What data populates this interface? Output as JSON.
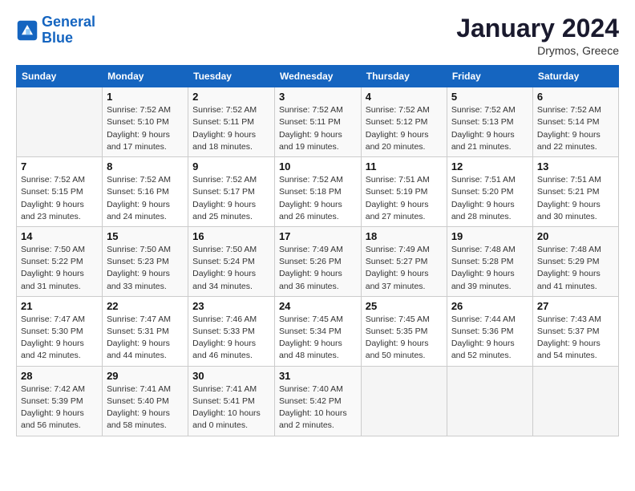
{
  "logo": {
    "line1": "General",
    "line2": "Blue"
  },
  "header": {
    "month": "January 2024",
    "location": "Drymos, Greece"
  },
  "columns": [
    "Sunday",
    "Monday",
    "Tuesday",
    "Wednesday",
    "Thursday",
    "Friday",
    "Saturday"
  ],
  "weeks": [
    [
      {
        "day": "",
        "detail": ""
      },
      {
        "day": "1",
        "detail": "Sunrise: 7:52 AM\nSunset: 5:10 PM\nDaylight: 9 hours\nand 17 minutes."
      },
      {
        "day": "2",
        "detail": "Sunrise: 7:52 AM\nSunset: 5:11 PM\nDaylight: 9 hours\nand 18 minutes."
      },
      {
        "day": "3",
        "detail": "Sunrise: 7:52 AM\nSunset: 5:11 PM\nDaylight: 9 hours\nand 19 minutes."
      },
      {
        "day": "4",
        "detail": "Sunrise: 7:52 AM\nSunset: 5:12 PM\nDaylight: 9 hours\nand 20 minutes."
      },
      {
        "day": "5",
        "detail": "Sunrise: 7:52 AM\nSunset: 5:13 PM\nDaylight: 9 hours\nand 21 minutes."
      },
      {
        "day": "6",
        "detail": "Sunrise: 7:52 AM\nSunset: 5:14 PM\nDaylight: 9 hours\nand 22 minutes."
      }
    ],
    [
      {
        "day": "7",
        "detail": "Sunrise: 7:52 AM\nSunset: 5:15 PM\nDaylight: 9 hours\nand 23 minutes."
      },
      {
        "day": "8",
        "detail": "Sunrise: 7:52 AM\nSunset: 5:16 PM\nDaylight: 9 hours\nand 24 minutes."
      },
      {
        "day": "9",
        "detail": "Sunrise: 7:52 AM\nSunset: 5:17 PM\nDaylight: 9 hours\nand 25 minutes."
      },
      {
        "day": "10",
        "detail": "Sunrise: 7:52 AM\nSunset: 5:18 PM\nDaylight: 9 hours\nand 26 minutes."
      },
      {
        "day": "11",
        "detail": "Sunrise: 7:51 AM\nSunset: 5:19 PM\nDaylight: 9 hours\nand 27 minutes."
      },
      {
        "day": "12",
        "detail": "Sunrise: 7:51 AM\nSunset: 5:20 PM\nDaylight: 9 hours\nand 28 minutes."
      },
      {
        "day": "13",
        "detail": "Sunrise: 7:51 AM\nSunset: 5:21 PM\nDaylight: 9 hours\nand 30 minutes."
      }
    ],
    [
      {
        "day": "14",
        "detail": "Sunrise: 7:50 AM\nSunset: 5:22 PM\nDaylight: 9 hours\nand 31 minutes."
      },
      {
        "day": "15",
        "detail": "Sunrise: 7:50 AM\nSunset: 5:23 PM\nDaylight: 9 hours\nand 33 minutes."
      },
      {
        "day": "16",
        "detail": "Sunrise: 7:50 AM\nSunset: 5:24 PM\nDaylight: 9 hours\nand 34 minutes."
      },
      {
        "day": "17",
        "detail": "Sunrise: 7:49 AM\nSunset: 5:26 PM\nDaylight: 9 hours\nand 36 minutes."
      },
      {
        "day": "18",
        "detail": "Sunrise: 7:49 AM\nSunset: 5:27 PM\nDaylight: 9 hours\nand 37 minutes."
      },
      {
        "day": "19",
        "detail": "Sunrise: 7:48 AM\nSunset: 5:28 PM\nDaylight: 9 hours\nand 39 minutes."
      },
      {
        "day": "20",
        "detail": "Sunrise: 7:48 AM\nSunset: 5:29 PM\nDaylight: 9 hours\nand 41 minutes."
      }
    ],
    [
      {
        "day": "21",
        "detail": "Sunrise: 7:47 AM\nSunset: 5:30 PM\nDaylight: 9 hours\nand 42 minutes."
      },
      {
        "day": "22",
        "detail": "Sunrise: 7:47 AM\nSunset: 5:31 PM\nDaylight: 9 hours\nand 44 minutes."
      },
      {
        "day": "23",
        "detail": "Sunrise: 7:46 AM\nSunset: 5:33 PM\nDaylight: 9 hours\nand 46 minutes."
      },
      {
        "day": "24",
        "detail": "Sunrise: 7:45 AM\nSunset: 5:34 PM\nDaylight: 9 hours\nand 48 minutes."
      },
      {
        "day": "25",
        "detail": "Sunrise: 7:45 AM\nSunset: 5:35 PM\nDaylight: 9 hours\nand 50 minutes."
      },
      {
        "day": "26",
        "detail": "Sunrise: 7:44 AM\nSunset: 5:36 PM\nDaylight: 9 hours\nand 52 minutes."
      },
      {
        "day": "27",
        "detail": "Sunrise: 7:43 AM\nSunset: 5:37 PM\nDaylight: 9 hours\nand 54 minutes."
      }
    ],
    [
      {
        "day": "28",
        "detail": "Sunrise: 7:42 AM\nSunset: 5:39 PM\nDaylight: 9 hours\nand 56 minutes."
      },
      {
        "day": "29",
        "detail": "Sunrise: 7:41 AM\nSunset: 5:40 PM\nDaylight: 9 hours\nand 58 minutes."
      },
      {
        "day": "30",
        "detail": "Sunrise: 7:41 AM\nSunset: 5:41 PM\nDaylight: 10 hours\nand 0 minutes."
      },
      {
        "day": "31",
        "detail": "Sunrise: 7:40 AM\nSunset: 5:42 PM\nDaylight: 10 hours\nand 2 minutes."
      },
      {
        "day": "",
        "detail": ""
      },
      {
        "day": "",
        "detail": ""
      },
      {
        "day": "",
        "detail": ""
      }
    ]
  ]
}
